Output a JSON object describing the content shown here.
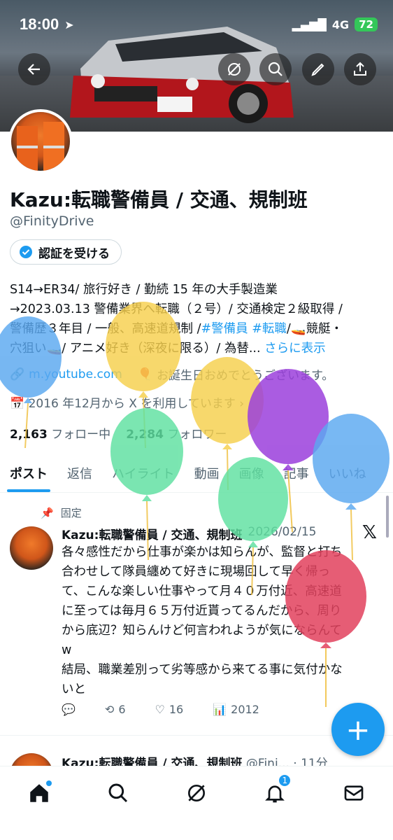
{
  "status": {
    "time": "18:00",
    "network": "4G",
    "battery": "72"
  },
  "profile": {
    "name": "Kazu:転職警備員 / 交通、規制班",
    "handle": "@FinityDrive",
    "verify_label": "認証を受ける",
    "bio": {
      "line1": "S14→ER34/ 旅行好き / 勤続 15 年の大手製造業",
      "line2": "→2023.03.13 警備業界へ転職（２号）/ 交通検定２級取得 /",
      "line3a": "警備歴３年目 / 一般、高速道規制 /",
      "tag1": "#警備員",
      "tag2": "#転職",
      "line3b": "/🚤競艇・",
      "line4": "穴狙い🚤/ アニメ好き（深夜に限る）/ 為替...",
      "more": "さらに表示"
    },
    "website": "m.youtube.com",
    "birthday": "お誕生日おめでとうございます。",
    "joined": "2016 年12月から X を利用しています",
    "following_count": "2,163",
    "following_label": "フォロー中",
    "followers_count": "2,284",
    "followers_label": "フォロワー"
  },
  "tabs": [
    "ポスト",
    "返信",
    "ハイライト",
    "動画",
    "画像",
    "記事",
    "いいね"
  ],
  "post": {
    "pinned_label": "固定",
    "author": "Kazu:転職警備員 / 交通、規制班",
    "date": "2026/02/15",
    "lines": [
      "各々感性だから仕事が楽かは知らんが、監督と打ち",
      "合わせして隊員纏めて好きに現場回して早く帰っ",
      "て、こんな楽しい仕事やって月４０万付近、高速道",
      "に至っては毎月６５万付近貰ってるんだから、周り",
      "から底辺？知らんけど何言われようが気にならんて",
      "w",
      "結局、職業差別って劣等感から来てる事に気付かな",
      "いと"
    ],
    "replies": "",
    "reposts": "6",
    "likes": "16",
    "views": "2012"
  },
  "post2": {
    "author": "Kazu:転職警備員 / 交通、規制班",
    "handle_time": "@Fini... · 11分"
  },
  "fab_label": "+",
  "notifications_badge": "1",
  "colors": {
    "accent": "#1d9bf0",
    "text": "#0f1419",
    "muted": "#536471"
  }
}
